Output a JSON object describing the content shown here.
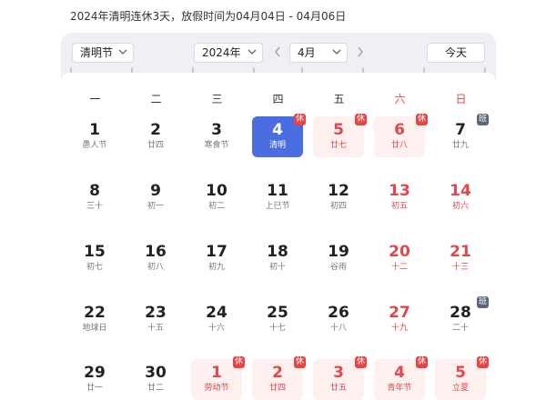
{
  "info_text": "2024年清明连休3天，放假时间为04月04日 - 04月06日",
  "toolbar": {
    "holiday_select": "清明节",
    "year_select": "2024年",
    "month_select": "4月",
    "today_label": "今天"
  },
  "weekdays": [
    "一",
    "二",
    "三",
    "四",
    "五",
    "六",
    "日"
  ],
  "days": [
    {
      "num": "1",
      "sub": "愚人节",
      "kind": "normal"
    },
    {
      "num": "2",
      "sub": "廿四",
      "kind": "normal"
    },
    {
      "num": "3",
      "sub": "寒食节",
      "kind": "normal"
    },
    {
      "num": "4",
      "sub": "清明",
      "kind": "selected",
      "badge": "休"
    },
    {
      "num": "5",
      "sub": "廿七",
      "kind": "holiday",
      "badge": "休"
    },
    {
      "num": "6",
      "sub": "廿八",
      "kind": "holiday",
      "badge": "休"
    },
    {
      "num": "7",
      "sub": "廿九",
      "kind": "normal",
      "badge": "班"
    },
    {
      "num": "8",
      "sub": "三十",
      "kind": "normal"
    },
    {
      "num": "9",
      "sub": "初一",
      "kind": "normal"
    },
    {
      "num": "10",
      "sub": "初二",
      "kind": "normal"
    },
    {
      "num": "11",
      "sub": "上巳节",
      "kind": "normal"
    },
    {
      "num": "12",
      "sub": "初四",
      "kind": "normal"
    },
    {
      "num": "13",
      "sub": "初五",
      "kind": "weekend"
    },
    {
      "num": "14",
      "sub": "初六",
      "kind": "weekend"
    },
    {
      "num": "15",
      "sub": "初七",
      "kind": "normal"
    },
    {
      "num": "16",
      "sub": "初八",
      "kind": "normal"
    },
    {
      "num": "17",
      "sub": "初九",
      "kind": "normal"
    },
    {
      "num": "18",
      "sub": "初十",
      "kind": "normal"
    },
    {
      "num": "19",
      "sub": "谷雨",
      "kind": "normal"
    },
    {
      "num": "20",
      "sub": "十二",
      "kind": "weekend"
    },
    {
      "num": "21",
      "sub": "十三",
      "kind": "weekend"
    },
    {
      "num": "22",
      "sub": "地球日",
      "kind": "normal"
    },
    {
      "num": "23",
      "sub": "十五",
      "kind": "normal"
    },
    {
      "num": "24",
      "sub": "十六",
      "kind": "normal"
    },
    {
      "num": "25",
      "sub": "十七",
      "kind": "normal"
    },
    {
      "num": "26",
      "sub": "十八",
      "kind": "normal"
    },
    {
      "num": "27",
      "sub": "十九",
      "kind": "weekend"
    },
    {
      "num": "28",
      "sub": "二十",
      "kind": "normal",
      "badge": "班"
    },
    {
      "num": "29",
      "sub": "廿一",
      "kind": "normal"
    },
    {
      "num": "30",
      "sub": "廿二",
      "kind": "normal"
    },
    {
      "num": "1",
      "sub": "劳动节",
      "kind": "holiday",
      "badge": "休"
    },
    {
      "num": "2",
      "sub": "廿四",
      "kind": "holiday",
      "badge": "休"
    },
    {
      "num": "3",
      "sub": "廿五",
      "kind": "holiday",
      "badge": "休"
    },
    {
      "num": "4",
      "sub": "青年节",
      "kind": "holiday",
      "badge": "休"
    },
    {
      "num": "5",
      "sub": "立夏",
      "kind": "holiday",
      "badge": "休"
    }
  ],
  "colors": {
    "accent": "#4a6ee0",
    "holiday_red": "#e0484e",
    "holiday_bg": "#fdf0ef",
    "work_badge": "#5b667a"
  },
  "icons": {
    "dropdown": "chevron-down-icon",
    "prev": "chevron-left-icon",
    "next": "chevron-right-icon"
  }
}
